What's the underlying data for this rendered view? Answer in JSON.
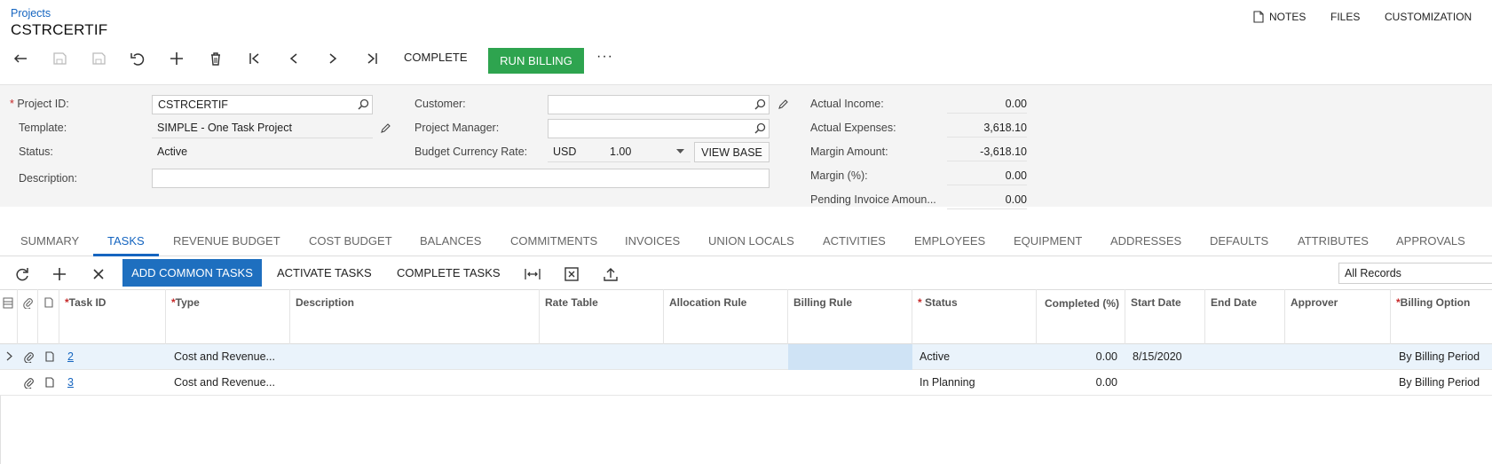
{
  "header": {
    "breadcrumb": "Projects",
    "title": "CSTRCERTIF",
    "links": {
      "notes": "NOTES",
      "files": "FILES",
      "customization": "CUSTOMIZATION"
    }
  },
  "toolbar": {
    "complete": "COMPLETE",
    "run_billing": "RUN BILLING",
    "more": "···"
  },
  "form": {
    "project_id_label": "Project ID:",
    "project_id": "CSTRCERTIF",
    "template_label": "Template:",
    "template": "SIMPLE - One Task Project",
    "status_label": "Status:",
    "status": "Active",
    "description_label": "Description:",
    "description": "",
    "customer_label": "Customer:",
    "customer": "",
    "pm_label": "Project Manager:",
    "pm": "",
    "bcr_label": "Budget Currency Rate:",
    "currency": "USD",
    "rate": "1.00",
    "view_base": "VIEW BASE",
    "actual_income_label": "Actual Income:",
    "actual_income": "0.00",
    "actual_expenses_label": "Actual Expenses:",
    "actual_expenses": "3,618.10",
    "margin_amount_label": "Margin Amount:",
    "margin_amount": "-3,618.10",
    "margin_pct_label": "Margin (%):",
    "margin_pct": "0.00",
    "pending_label": "Pending Invoice Amoun...",
    "pending": "0.00"
  },
  "tabs": [
    "SUMMARY",
    "TASKS",
    "REVENUE BUDGET",
    "COST BUDGET",
    "BALANCES",
    "COMMITMENTS",
    "INVOICES",
    "UNION LOCALS",
    "ACTIVITIES",
    "EMPLOYEES",
    "EQUIPMENT",
    "ADDRESSES",
    "DEFAULTS",
    "ATTRIBUTES",
    "APPROVALS"
  ],
  "active_tab": "TASKS",
  "grid_toolbar": {
    "add_common": "ADD COMMON TASKS",
    "activate": "ACTIVATE TASKS",
    "complete": "COMPLETE TASKS",
    "filter": "All Records"
  },
  "columns": {
    "task_id": "Task ID",
    "type": "Type",
    "description": "Description",
    "rate_table": "Rate Table",
    "allocation_rule": "Allocation Rule",
    "billing_rule": "Billing Rule",
    "status": "Status",
    "completed": "Completed (%)",
    "start_date": "Start Date",
    "end_date": "End Date",
    "approver": "Approver",
    "billing_option": "Billing Option"
  },
  "rows": [
    {
      "task_id": "2",
      "type": "Cost and Revenue...",
      "status": "Active",
      "completed": "0.00",
      "start_date": "8/15/2020",
      "billing_option": "By Billing Period"
    },
    {
      "task_id": "3",
      "type": "Cost and Revenue...",
      "status": "In Planning",
      "completed": "0.00",
      "start_date": "",
      "billing_option": "By Billing Period"
    }
  ],
  "colors": {
    "accent": "#1565c0",
    "green": "#2ea44f",
    "blue_button": "#1e6fbf",
    "selected_row": "#eaf3fb",
    "selected_cell": "#cfe3f5"
  }
}
